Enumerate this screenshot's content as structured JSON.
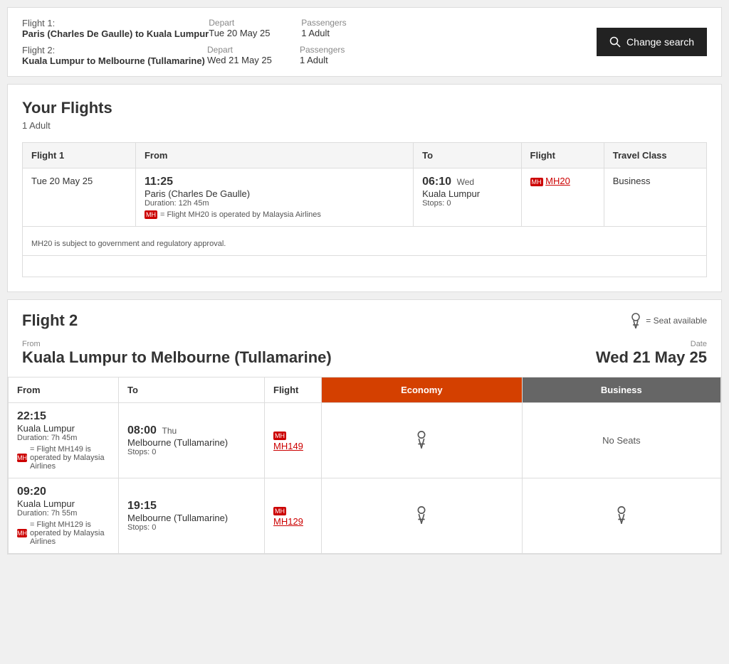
{
  "topBar": {
    "flight1": {
      "label": "Flight 1:",
      "route": "Paris (Charles De Gaulle)  to  Kuala Lumpur",
      "departLabel": "Depart",
      "departDate": "Tue 20 May 25",
      "passengersLabel": "Passengers",
      "passengers": "1 Adult"
    },
    "flight2": {
      "label": "Flight 2:",
      "route": "Kuala Lumpur  to  Melbourne (Tullamarine)",
      "departLabel": "Depart",
      "departDate": "Wed 21 May 25",
      "passengersLabel": "Passengers",
      "passengers": "1 Adult"
    },
    "changeSearchBtn": "Change search"
  },
  "yourFlights": {
    "title": "Your Flights",
    "subtitle": "1 Adult",
    "table": {
      "headers": [
        "Flight 1",
        "From",
        "To",
        "Flight",
        "Travel Class"
      ],
      "row": {
        "date": "Tue 20 May 25",
        "departTime": "11:25",
        "departCity": "Paris (Charles De Gaulle)",
        "duration": "Duration: 12h 45m",
        "arriveTime": "06:10",
        "arriveDay": "Wed",
        "arriveCity": "Kuala Lumpur",
        "stops": "0",
        "stopsLabel": "Stops:",
        "flightCode": "MH20",
        "travelClass": "Business",
        "operatedBy": "= Flight MH20 is operated by Malaysia Airlines",
        "note": "MH20 is subject to government and regulatory approval."
      }
    }
  },
  "flight2Section": {
    "title": "Flight 2",
    "seatAvailable": "= Seat available",
    "fromLabel": "From",
    "dateLabel": "Date",
    "route": "Kuala Lumpur to Melbourne (Tullamarine)",
    "date": "Wed 21 May 25",
    "tableHeaders": {
      "from": "From",
      "to": "To",
      "flight": "Flight",
      "economy": "Economy",
      "business": "Business"
    },
    "rows": [
      {
        "departTime": "22:15",
        "departCity": "Kuala Lumpur",
        "duration": "Duration: 7h 45m",
        "flightCode": "MH149",
        "arriveTime": "08:00",
        "arriveDay": "Thu",
        "arriveCity": "Melbourne (Tullamarine)",
        "stops": "0",
        "operatedBy": "= Flight MH149 is operated by Malaysia Airlines",
        "economySeats": "seat",
        "businessSeats": "No Seats"
      },
      {
        "departTime": "09:20",
        "departCity": "Kuala Lumpur",
        "duration": "Duration: 7h 55m",
        "flightCode": "MH129",
        "arriveTime": "19:15",
        "arriveDay": "",
        "arriveCity": "Melbourne (Tullamarine)",
        "stops": "0",
        "operatedBy": "= Flight MH129 is operated by Malaysia Airlines",
        "economySeats": "seat",
        "businessSeats": "seat"
      }
    ]
  }
}
